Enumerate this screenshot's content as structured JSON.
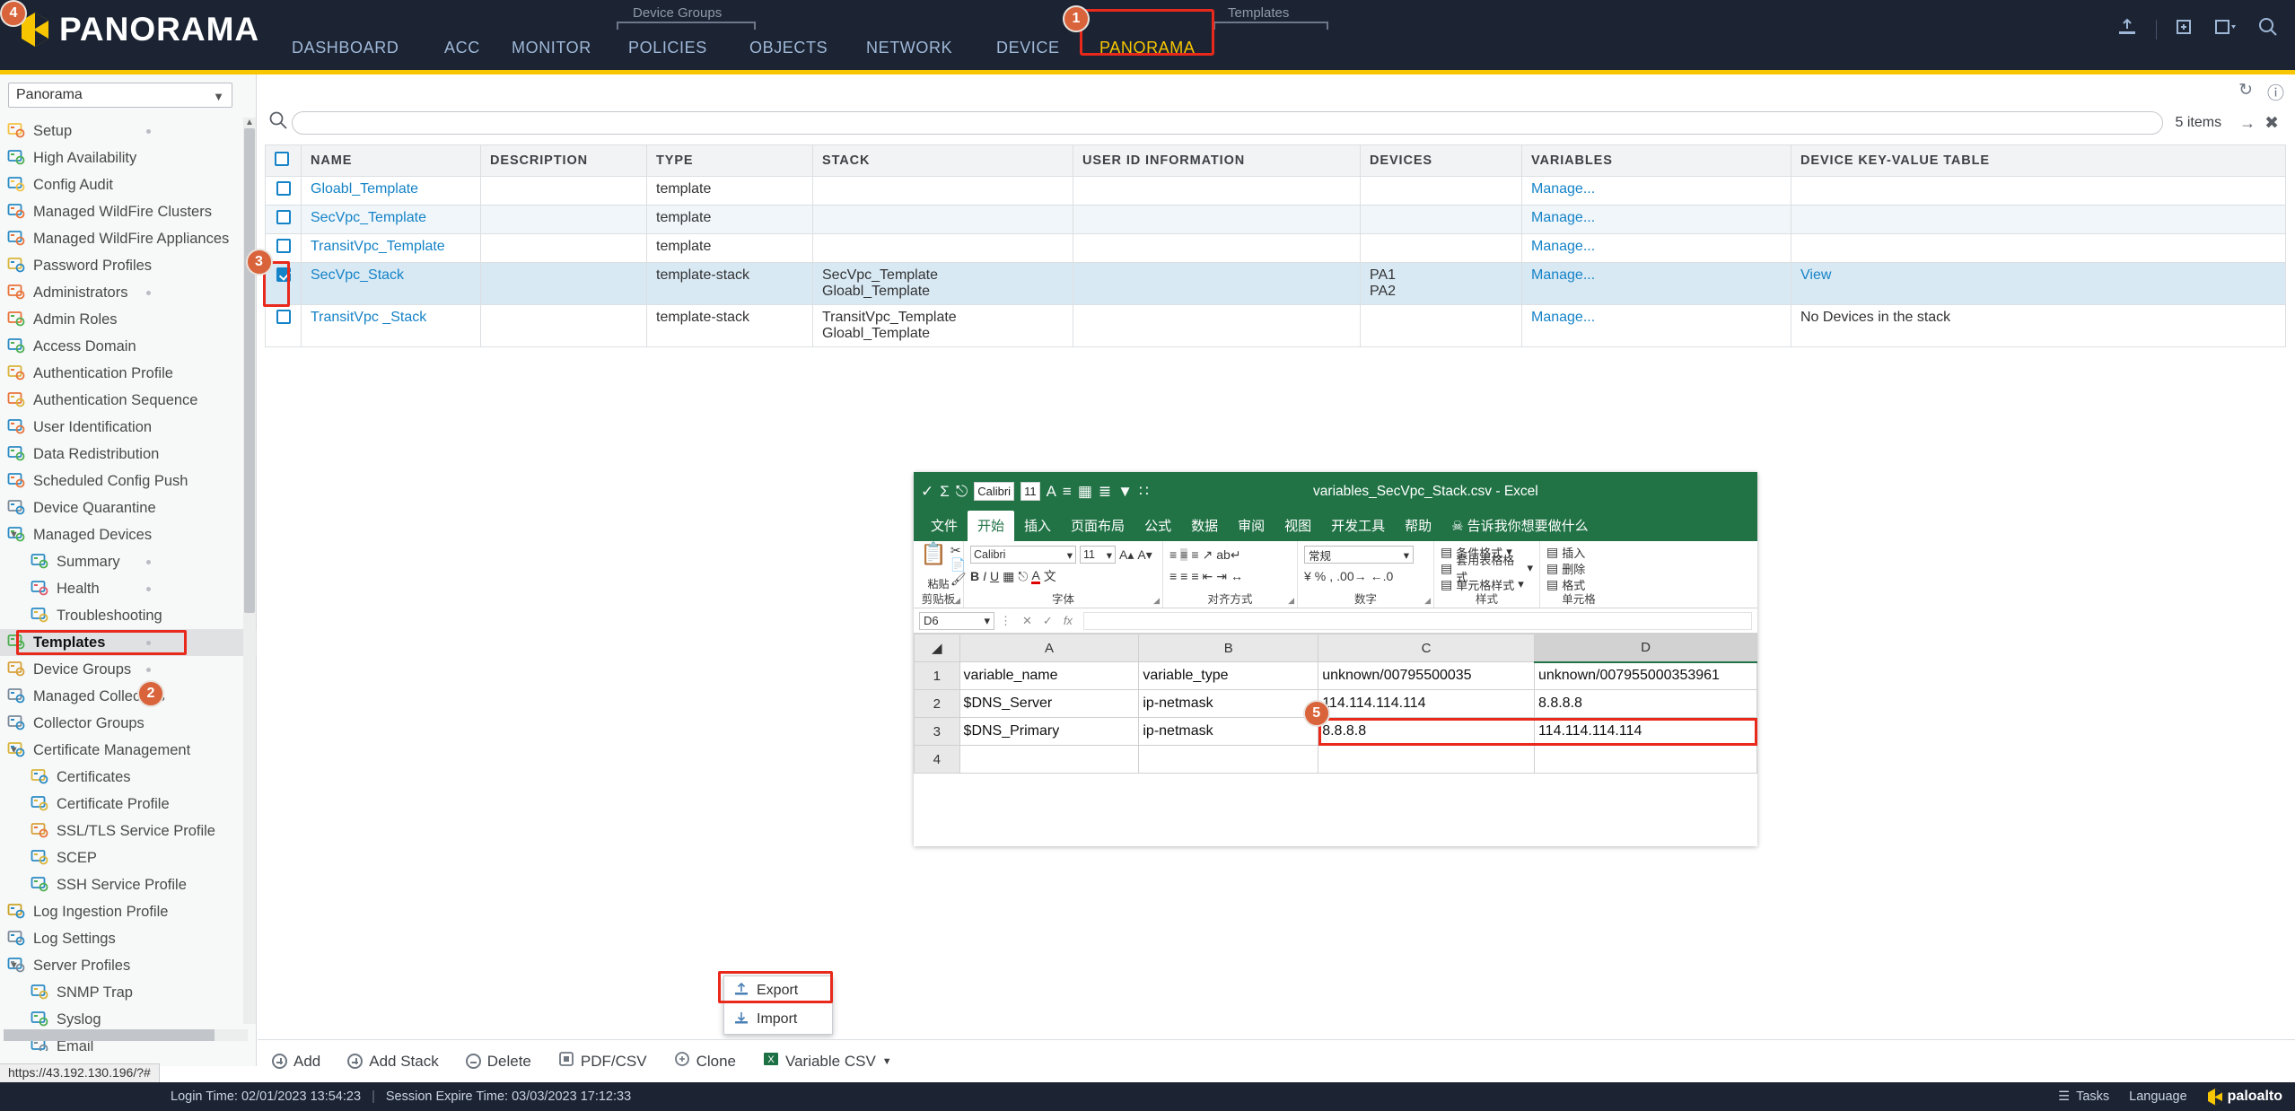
{
  "app": {
    "brand": "PANORAMA"
  },
  "topnav": {
    "items": [
      {
        "label": "DASHBOARD",
        "active": false
      },
      {
        "label": "ACC",
        "active": false
      },
      {
        "label": "MONITOR",
        "active": false
      },
      {
        "label": "POLICIES",
        "active": false
      },
      {
        "label": "OBJECTS",
        "active": false
      },
      {
        "label": "NETWORK",
        "active": false
      },
      {
        "label": "DEVICE",
        "active": false
      },
      {
        "label": "PANORAMA",
        "active": true
      }
    ],
    "group_labels": [
      "Device Groups",
      "Templates"
    ],
    "marker_1": "1"
  },
  "sidebar": {
    "context_value": "Panorama",
    "marker_2": "2",
    "items": [
      {
        "label": "Setup",
        "icon": "setup-icon",
        "level": 0,
        "dot": true
      },
      {
        "label": "High Availability",
        "icon": "high-availability-icon",
        "level": 0,
        "dot": false
      },
      {
        "label": "Config Audit",
        "icon": "config-audit-icon",
        "level": 0,
        "dot": false
      },
      {
        "label": "Managed WildFire Clusters",
        "icon": "wildfire-cluster-icon",
        "level": 0,
        "dot": false
      },
      {
        "label": "Managed WildFire Appliances",
        "icon": "wildfire-appliance-icon",
        "level": 0,
        "dot": false
      },
      {
        "label": "Password Profiles",
        "icon": "password-profile-icon",
        "level": 0,
        "dot": false
      },
      {
        "label": "Administrators",
        "icon": "administrators-icon",
        "level": 0,
        "dot": true
      },
      {
        "label": "Admin Roles",
        "icon": "admin-roles-icon",
        "level": 0,
        "dot": false
      },
      {
        "label": "Access Domain",
        "icon": "access-domain-icon",
        "level": 0,
        "dot": false
      },
      {
        "label": "Authentication Profile",
        "icon": "auth-profile-icon",
        "level": 0,
        "dot": false
      },
      {
        "label": "Authentication Sequence",
        "icon": "auth-sequence-icon",
        "level": 0,
        "dot": false
      },
      {
        "label": "User Identification",
        "icon": "user-identification-icon",
        "level": 0,
        "dot": false
      },
      {
        "label": "Data Redistribution",
        "icon": "data-redistribution-icon",
        "level": 0,
        "dot": false
      },
      {
        "label": "Scheduled Config Push",
        "icon": "scheduled-config-push-icon",
        "level": 0,
        "dot": false
      },
      {
        "label": "Device Quarantine",
        "icon": "device-quarantine-icon",
        "level": 0,
        "dot": false
      },
      {
        "label": "Managed Devices",
        "icon": "managed-devices-icon",
        "level": 0,
        "dot": false,
        "expanded": true
      },
      {
        "label": "Summary",
        "icon": "summary-icon",
        "level": 1,
        "dot": true
      },
      {
        "label": "Health",
        "icon": "health-icon",
        "level": 1,
        "dot": true
      },
      {
        "label": "Troubleshooting",
        "icon": "troubleshooting-icon",
        "level": 1,
        "dot": false
      },
      {
        "label": "Templates",
        "icon": "templates-icon",
        "level": 0,
        "dot": true,
        "selected": true
      },
      {
        "label": "Device Groups",
        "icon": "device-groups-icon",
        "level": 0,
        "dot": true
      },
      {
        "label": "Managed Collectors",
        "icon": "managed-collectors-icon",
        "level": 0,
        "dot": false
      },
      {
        "label": "Collector Groups",
        "icon": "collector-groups-icon",
        "level": 0,
        "dot": false
      },
      {
        "label": "Certificate Management",
        "icon": "certificate-management-icon",
        "level": 0,
        "dot": false,
        "expanded": true
      },
      {
        "label": "Certificates",
        "icon": "certificates-icon",
        "level": 1,
        "dot": false
      },
      {
        "label": "Certificate Profile",
        "icon": "certificate-profile-icon",
        "level": 1,
        "dot": false
      },
      {
        "label": "SSL/TLS Service Profile",
        "icon": "ssl-tls-service-profile-icon",
        "level": 1,
        "dot": false
      },
      {
        "label": "SCEP",
        "icon": "scep-icon",
        "level": 1,
        "dot": false
      },
      {
        "label": "SSH Service Profile",
        "icon": "ssh-service-profile-icon",
        "level": 1,
        "dot": false
      },
      {
        "label": "Log Ingestion Profile",
        "icon": "log-ingestion-profile-icon",
        "level": 0,
        "dot": false
      },
      {
        "label": "Log Settings",
        "icon": "log-settings-icon",
        "level": 0,
        "dot": false
      },
      {
        "label": "Server Profiles",
        "icon": "server-profiles-icon",
        "level": 0,
        "dot": false,
        "expanded": true
      },
      {
        "label": "SNMP Trap",
        "icon": "snmp-trap-icon",
        "level": 1,
        "dot": false
      },
      {
        "label": "Syslog",
        "icon": "syslog-icon",
        "level": 1,
        "dot": false
      },
      {
        "label": "Email",
        "icon": "email-icon",
        "level": 1,
        "dot": false
      }
    ]
  },
  "main": {
    "search_placeholder": "",
    "search_value": "",
    "item_count": "5 items",
    "marker_3": "3",
    "columns": [
      "NAME",
      "DESCRIPTION",
      "TYPE",
      "STACK",
      "USER ID INFORMATION",
      "DEVICES",
      "VARIABLES",
      "DEVICE KEY-VALUE TABLE"
    ],
    "rows": [
      {
        "checked": false,
        "name": "Gloabl_Template",
        "description": "",
        "type": "template",
        "stack": "",
        "userid": "",
        "devices": "",
        "variables": "Manage...",
        "kvtable": "",
        "selected": false
      },
      {
        "checked": false,
        "name": "SecVpc_Template",
        "description": "",
        "type": "template",
        "stack": "",
        "userid": "",
        "devices": "",
        "variables": "Manage...",
        "kvtable": "",
        "selected": false
      },
      {
        "checked": false,
        "name": "TransitVpc_Template",
        "description": "",
        "type": "template",
        "stack": "",
        "userid": "",
        "devices": "",
        "variables": "Manage...",
        "kvtable": "",
        "selected": false
      },
      {
        "checked": true,
        "name": "SecVpc_Stack",
        "description": "",
        "type": "template-stack",
        "stack": "SecVpc_Template\nGloabl_Template",
        "userid": "",
        "devices": "PA1\nPA2",
        "variables": "Manage...",
        "kvtable": "View",
        "selected": true
      },
      {
        "checked": false,
        "name": "TransitVpc _Stack",
        "description": "",
        "type": "template-stack",
        "stack": "TransitVpc_Template\nGloabl_Template",
        "userid": "",
        "devices": "",
        "variables": "Manage...",
        "kvtable": "No Devices in the stack",
        "selected": false
      }
    ]
  },
  "excel": {
    "title": "variables_SecVpc_Stack.csv  -  Excel",
    "qat_font": "Calibri",
    "qat_size": "11",
    "tabs": [
      "文件",
      "开始",
      "插入",
      "页面布局",
      "公式",
      "数据",
      "审阅",
      "视图",
      "开发工具",
      "帮助"
    ],
    "active_tab": "开始",
    "tell_me": "告诉我你想要做什么",
    "ribbon": {
      "clipboard": {
        "name": "剪贴板",
        "paste": "粘贴"
      },
      "font": {
        "name": "字体",
        "family": "Calibri",
        "size": "11"
      },
      "alignment": {
        "name": "对齐方式"
      },
      "number": {
        "name": "数字",
        "format": "常规"
      },
      "styles": {
        "name": "样式",
        "items": [
          "条件格式",
          "套用表格格式",
          "单元格样式"
        ]
      },
      "cells": {
        "name": "单元格",
        "items": [
          "插入",
          "删除",
          "格式"
        ]
      }
    },
    "namebox": "D6",
    "formula_value": "",
    "col_headers": [
      "A",
      "B",
      "C",
      "D"
    ],
    "row_headers": [
      "1",
      "2",
      "3",
      "4"
    ],
    "active_column": "D",
    "marker_5": "5",
    "cells": [
      [
        "variable_name",
        "variable_type",
        "unknown/00795500035",
        "unknown/007955000353961"
      ],
      [
        "$DNS_Server",
        "ip-netmask",
        "114.114.114.114",
        "8.8.8.8"
      ],
      [
        "$DNS_Primary",
        "ip-netmask",
        "8.8.8.8",
        "114.114.114.114"
      ],
      [
        "",
        "",
        "",
        ""
      ]
    ]
  },
  "export_menu": {
    "marker_4": "4",
    "items": [
      {
        "label": "Export",
        "icon": "export-icon",
        "highlighted": true
      },
      {
        "label": "Import",
        "icon": "import-icon",
        "highlighted": false
      }
    ]
  },
  "bottom_toolbar": {
    "buttons": [
      {
        "label": "Add",
        "icon": "plus-circle-icon"
      },
      {
        "label": "Add Stack",
        "icon": "plus-circle-icon"
      },
      {
        "label": "Delete",
        "icon": "minus-circle-icon"
      },
      {
        "label": "PDF/CSV",
        "icon": "pdf-csv-icon"
      },
      {
        "label": "Clone",
        "icon": "clone-icon"
      },
      {
        "label": "Variable CSV",
        "icon": "excel-icon",
        "caret": true
      }
    ]
  },
  "status_bar": {
    "url_hint": "https://43.192.130.196/?#",
    "login_time": "Login Time: 02/01/2023 13:54:23",
    "session_expire": "Session Expire Time: 03/03/2023 17:12:33",
    "tasks": "Tasks",
    "language": "Language",
    "vendor": "paloalto"
  },
  "colors": {
    "brand_dark": "#1c2433",
    "accent_yellow": "#f7c600",
    "highlight_red": "#e8291c",
    "marker_orange": "#d9633b",
    "link_blue": "#1583c7",
    "excel_green": "#217346"
  }
}
